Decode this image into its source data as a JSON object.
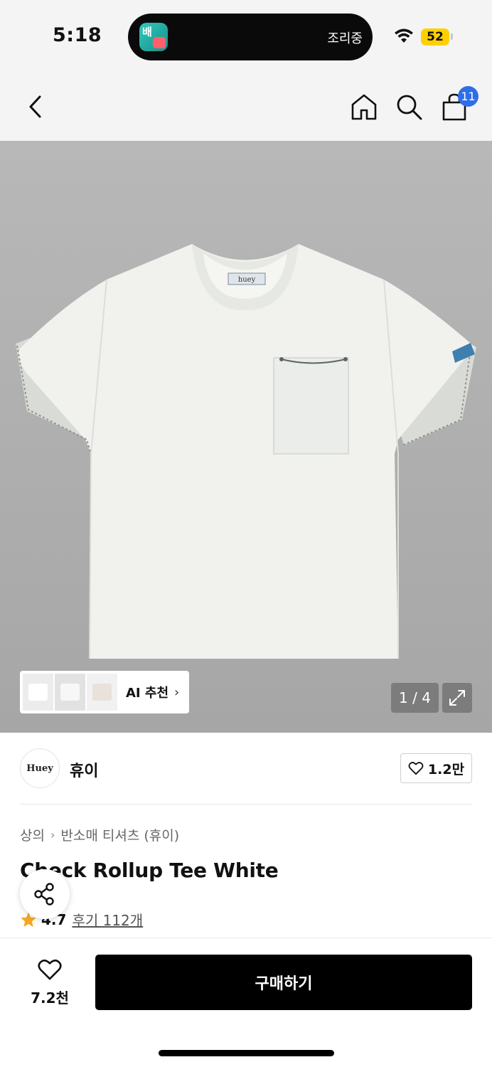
{
  "status_bar": {
    "time": "5:18",
    "live_activity_app_label": "배",
    "live_activity_text": "조리중",
    "battery": "52"
  },
  "nav": {
    "cart_badge": "11"
  },
  "gallery": {
    "ai_label": "AI 추천",
    "ai_chevron": "›",
    "page_indicator": "1 / 4",
    "tag_text": "huey"
  },
  "brand": {
    "logo_text": "Huey",
    "name": "휴이",
    "like_count": "1.2만"
  },
  "product": {
    "breadcrumb": [
      "상의",
      "반소매 티셔츠 (휴이)"
    ],
    "breadcrumb_sep": "›",
    "title": "Check Rollup Tee White",
    "rating": "4.7",
    "review_link": "후기 112개"
  },
  "bottom_bar": {
    "wish_count": "7.2천",
    "buy_label": "구매하기"
  },
  "colors": {
    "accent_blue": "#2f6ee8",
    "star": "#f5a623",
    "buy_bg": "#000000"
  },
  "icons": [
    "back-arrow-icon",
    "home-icon",
    "search-icon",
    "shopping-bag-icon",
    "expand-icon",
    "heart-icon",
    "share-icon",
    "star-icon",
    "wifi-icon"
  ]
}
